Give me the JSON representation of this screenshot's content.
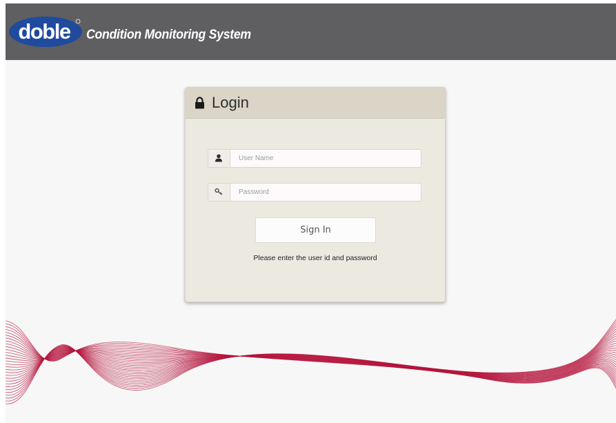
{
  "header": {
    "logo_text": "doble",
    "app_title": "Condition Monitoring System"
  },
  "login": {
    "title": "Login",
    "username": {
      "placeholder": "User Name",
      "value": ""
    },
    "password": {
      "placeholder": "Password",
      "value": ""
    },
    "signin_label": "Sign In",
    "hint": "Please enter the user id and password"
  },
  "colors": {
    "header_bg": "#5f5f61",
    "logo_blue": "#1f4a9e",
    "panel_bg": "#ece9e1",
    "panel_header_bg": "#dad5c6",
    "wave": "#b5163e"
  },
  "icons": {
    "title_icon": "lock-icon",
    "username_icon": "user-icon",
    "password_icon": "key-icon"
  }
}
